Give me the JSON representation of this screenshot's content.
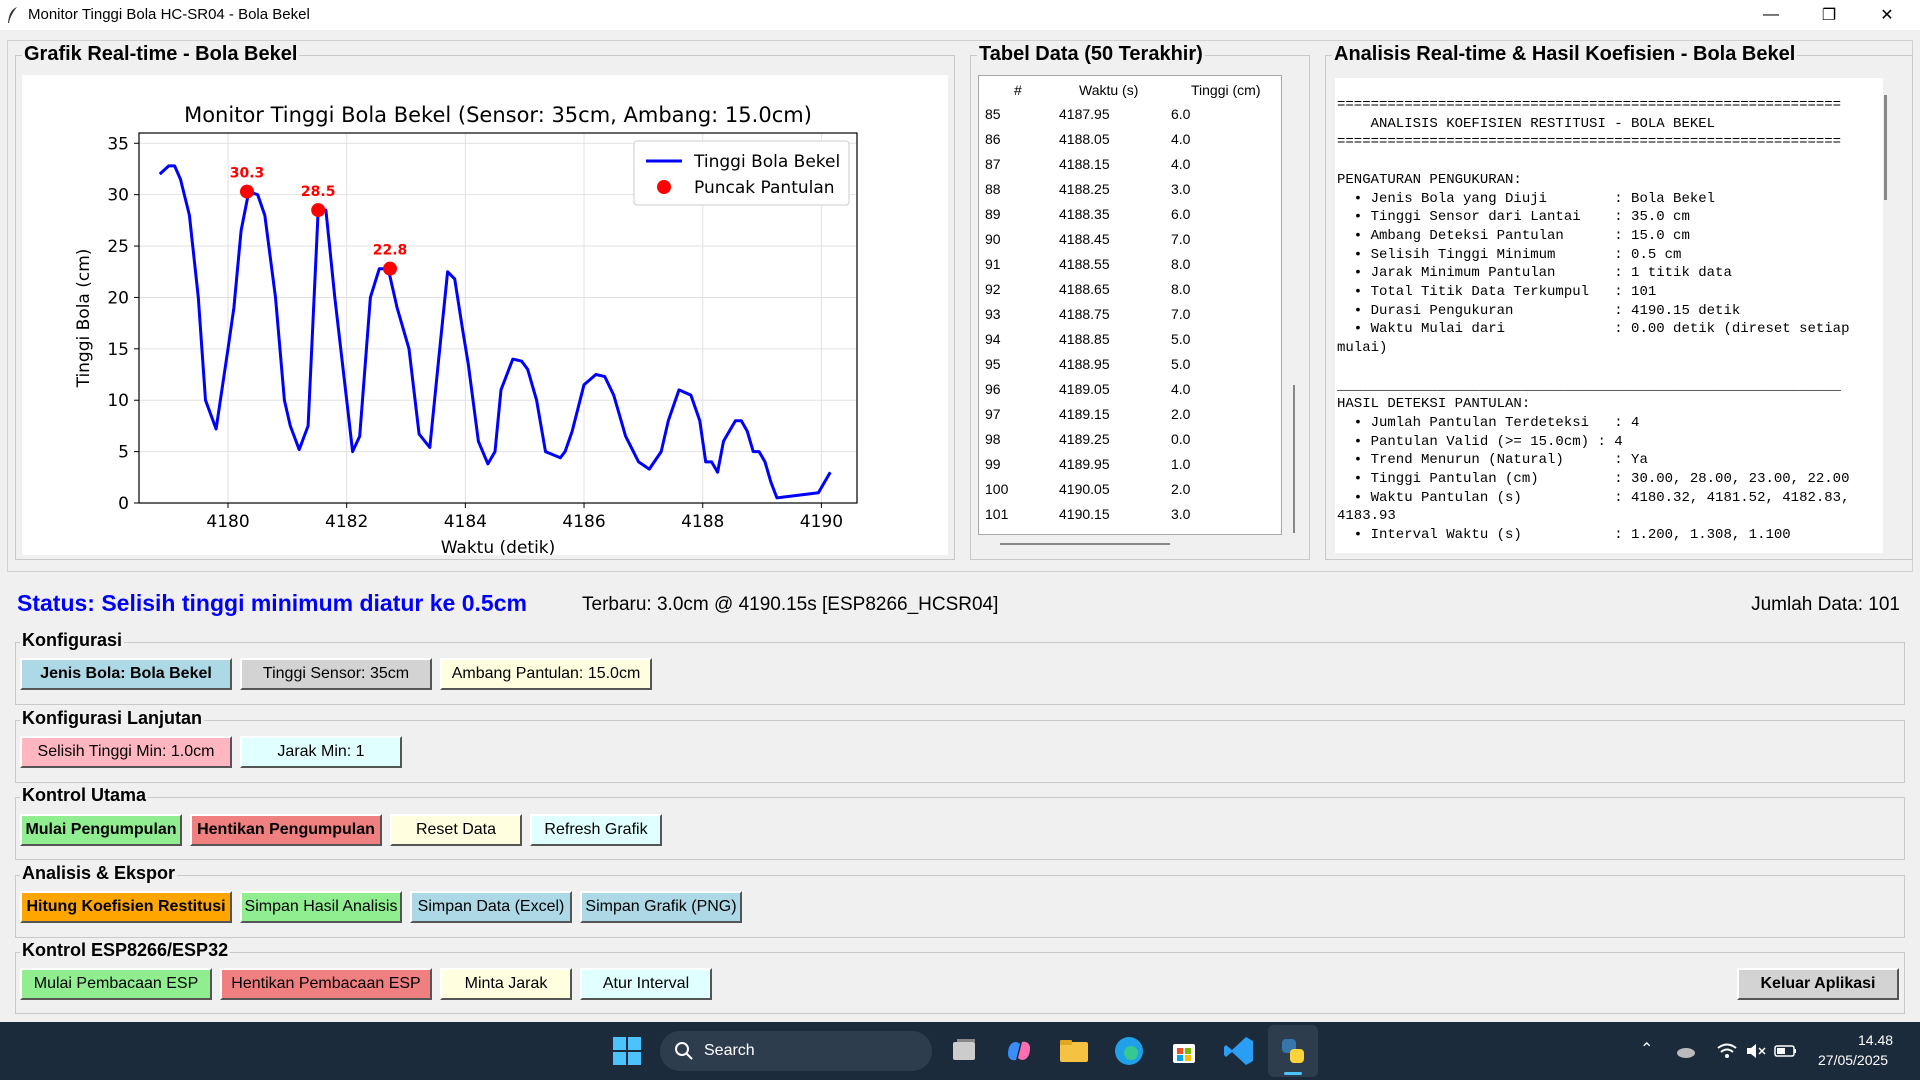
{
  "window": {
    "title": "Monitor Tinggi Bola HC-SR04 - Bola Bekel",
    "minimize": "—",
    "restore": "❐",
    "close": "✕"
  },
  "panels": {
    "chart_title": "Grafik Real-time - Bola Bekel",
    "table_title": "Tabel Data (50 Terakhir)",
    "analysis_title": "Analisis Real-time & Hasil Koefisien - Bola Bekel"
  },
  "chart_data": {
    "type": "line",
    "title": "Monitor Tinggi Bola Bekel (Sensor: 35cm, Ambang: 15.0cm)",
    "xlabel": "Waktu (detik)",
    "ylabel": "Tinggi Bola (cm)",
    "xlim": [
      4178.5,
      4190.6
    ],
    "ylim": [
      0,
      36
    ],
    "xticks": [
      4180,
      4182,
      4184,
      4186,
      4188,
      4190
    ],
    "yticks": [
      0,
      5,
      10,
      15,
      20,
      25,
      30,
      35
    ],
    "grid": true,
    "legend_position": "top-right",
    "series": [
      {
        "name": "Tinggi Bola Bekel",
        "color": "#0000ff",
        "x": [
          4178.85,
          4179.0,
          4179.1,
          4179.2,
          4179.35,
          4179.5,
          4179.62,
          4179.8,
          4180.0,
          4180.1,
          4180.22,
          4180.35,
          4180.5,
          4180.62,
          4180.8,
          4180.95,
          4181.05,
          4181.2,
          4181.35,
          4181.52,
          4181.65,
          4181.8,
          4182.0,
          4182.1,
          4182.22,
          4182.4,
          4182.55,
          4182.7,
          4182.85,
          4183.05,
          4183.22,
          4183.4,
          4183.55,
          4183.7,
          4183.82,
          4183.95,
          4184.05,
          4184.22,
          4184.38,
          4184.5,
          4184.6,
          4184.8,
          4184.95,
          4185.05,
          4185.2,
          4185.35,
          4185.6,
          4185.68,
          4185.8,
          4186.0,
          4186.2,
          4186.35,
          4186.5,
          4186.7,
          4186.92,
          4187.1,
          4187.3,
          4187.42,
          4187.6,
          4187.8,
          4187.95,
          4188.05,
          4188.15,
          4188.25,
          4188.35,
          4188.45,
          4188.55,
          4188.65,
          4188.75,
          4188.85,
          4188.95,
          4189.05,
          4189.15,
          4189.25,
          4189.95,
          4190.05,
          4190.15
        ],
        "y": [
          32.0,
          32.8,
          32.8,
          31.5,
          28.0,
          20.0,
          10.0,
          7.2,
          15.0,
          19.0,
          26.5,
          30.3,
          30.0,
          28.0,
          20.0,
          10.0,
          7.5,
          5.2,
          7.5,
          28.5,
          28.5,
          20.0,
          10.0,
          5.0,
          6.5,
          20.0,
          22.8,
          22.8,
          19.0,
          15.0,
          6.7,
          5.4,
          14.0,
          22.5,
          21.8,
          17.0,
          13.5,
          6.0,
          3.8,
          5.0,
          11.0,
          14.0,
          13.8,
          13.0,
          10.0,
          5.0,
          4.4,
          5.0,
          7.0,
          11.5,
          12.5,
          12.3,
          10.5,
          6.5,
          4.0,
          3.3,
          5.0,
          8.0,
          11.0,
          10.5,
          8.0,
          4.0,
          4.0,
          3.0,
          6.0,
          7.0,
          8.0,
          8.0,
          7.0,
          5.0,
          5.0,
          4.0,
          2.0,
          0.5,
          1.0,
          2.0,
          3.0
        ]
      },
      {
        "name": "Puncak Pantulan",
        "color": "#ff0000",
        "x": [
          4180.32,
          4181.52,
          4182.73
        ],
        "y": [
          30.3,
          28.5,
          22.8
        ],
        "labels": [
          "30.3",
          "28.5",
          "22.8"
        ]
      }
    ]
  },
  "table": {
    "headers": [
      "#",
      "Waktu (s)",
      "Tinggi (cm)"
    ],
    "rows": [
      [
        "85",
        "4187.95",
        "6.0"
      ],
      [
        "86",
        "4188.05",
        "4.0"
      ],
      [
        "87",
        "4188.15",
        "4.0"
      ],
      [
        "88",
        "4188.25",
        "3.0"
      ],
      [
        "89",
        "4188.35",
        "6.0"
      ],
      [
        "90",
        "4188.45",
        "7.0"
      ],
      [
        "91",
        "4188.55",
        "8.0"
      ],
      [
        "92",
        "4188.65",
        "8.0"
      ],
      [
        "93",
        "4188.75",
        "7.0"
      ],
      [
        "94",
        "4188.85",
        "5.0"
      ],
      [
        "95",
        "4188.95",
        "5.0"
      ],
      [
        "96",
        "4189.05",
        "4.0"
      ],
      [
        "97",
        "4189.15",
        "2.0"
      ],
      [
        "98",
        "4189.25",
        "0.0"
      ],
      [
        "99",
        "4189.95",
        "1.0"
      ],
      [
        "100",
        "4190.05",
        "2.0"
      ],
      [
        "101",
        "4190.15",
        "3.0"
      ]
    ]
  },
  "analysis_text": "============================================================\n    ANALISIS KOEFISIEN RESTITUSI - BOLA BEKEL\n============================================================\n\nPENGATURAN PENGUKURAN:\n  • Jenis Bola yang Diuji        : Bola Bekel\n  • Tinggi Sensor dari Lantai    : 35.0 cm\n  • Ambang Deteksi Pantulan      : 15.0 cm\n  • Selisih Tinggi Minimum       : 0.5 cm\n  • Jarak Minimum Pantulan       : 1 titik data\n  • Total Titik Data Terkumpul   : 101\n  • Durasi Pengukuran            : 4190.15 detik\n  • Waktu Mulai dari             : 0.00 detik (direset setiap\nmulai)\n\n____________________________________________________________\nHASIL DETEKSI PANTULAN:\n  • Jumlah Pantulan Terdeteksi   : 4\n  • Pantulan Valid (>= 15.0cm) : 4\n  • Trend Menurun (Natural)      : Ya\n  • Tinggi Pantulan (cm)         : 30.00, 28.00, 23.00, 22.00\n  • Waktu Pantulan (s)           : 4180.32, 4181.52, 4182.83,\n4183.93\n  • Interval Waktu (s)           : 1.200, 1.308, 1.100",
  "status": {
    "message": "Status: Selisih tinggi minimum diatur ke 0.5cm",
    "latest": "Terbaru: 3.0cm @ 4190.15s [ESP8266_HCSR04]",
    "count": "Jumlah Data: 101"
  },
  "sections": {
    "konfigurasi": {
      "label": "Konfigurasi",
      "jenis": "Jenis Bola: Bola Bekel",
      "tinggi": "Tinggi Sensor: 35cm",
      "ambang": "Ambang Pantulan: 15.0cm"
    },
    "lanjutan": {
      "label": "Konfigurasi Lanjutan",
      "selisih": "Selisih Tinggi Min: 1.0cm",
      "jarak": "Jarak Min: 1"
    },
    "kontrol": {
      "label": "Kontrol Utama",
      "mulai": "Mulai Pengumpulan",
      "hentikan": "Hentikan Pengumpulan",
      "reset": "Reset Data",
      "refresh": "Refresh Grafik"
    },
    "analisis": {
      "label": "Analisis & Ekspor",
      "hitung": "Hitung Koefisien Restitusi",
      "simpan_hasil": "Simpan Hasil Analisis",
      "simpan_data": "Simpan Data (Excel)",
      "simpan_grafik": "Simpan Grafik (PNG)"
    },
    "esp": {
      "label": "Kontrol ESP8266/ESP32",
      "mulai": "Mulai Pembacaan ESP",
      "hentikan": "Hentikan Pembacaan ESP",
      "minta": "Minta Jarak",
      "atur": "Atur Interval",
      "keluar": "Keluar Aplikasi"
    }
  },
  "colors": {
    "btn_blue": "#add8e6",
    "btn_gray": "#d3d3d3",
    "btn_yellow": "#ffffe0",
    "btn_pink": "#ffb6c1",
    "btn_cyan": "#e0ffff",
    "btn_green": "#90ee90",
    "btn_red": "#f08080",
    "btn_orange": "#ffa500",
    "status_blue": "#0000ff"
  },
  "taskbar": {
    "search_placeholder": "Search",
    "time": "14.48",
    "date": "27/05/2025",
    "icons": [
      "windows-start-icon",
      "task-view-icon",
      "copilot-icon",
      "file-explorer-icon",
      "edge-icon",
      "store-icon",
      "vscode-icon",
      "python-icon"
    ]
  }
}
